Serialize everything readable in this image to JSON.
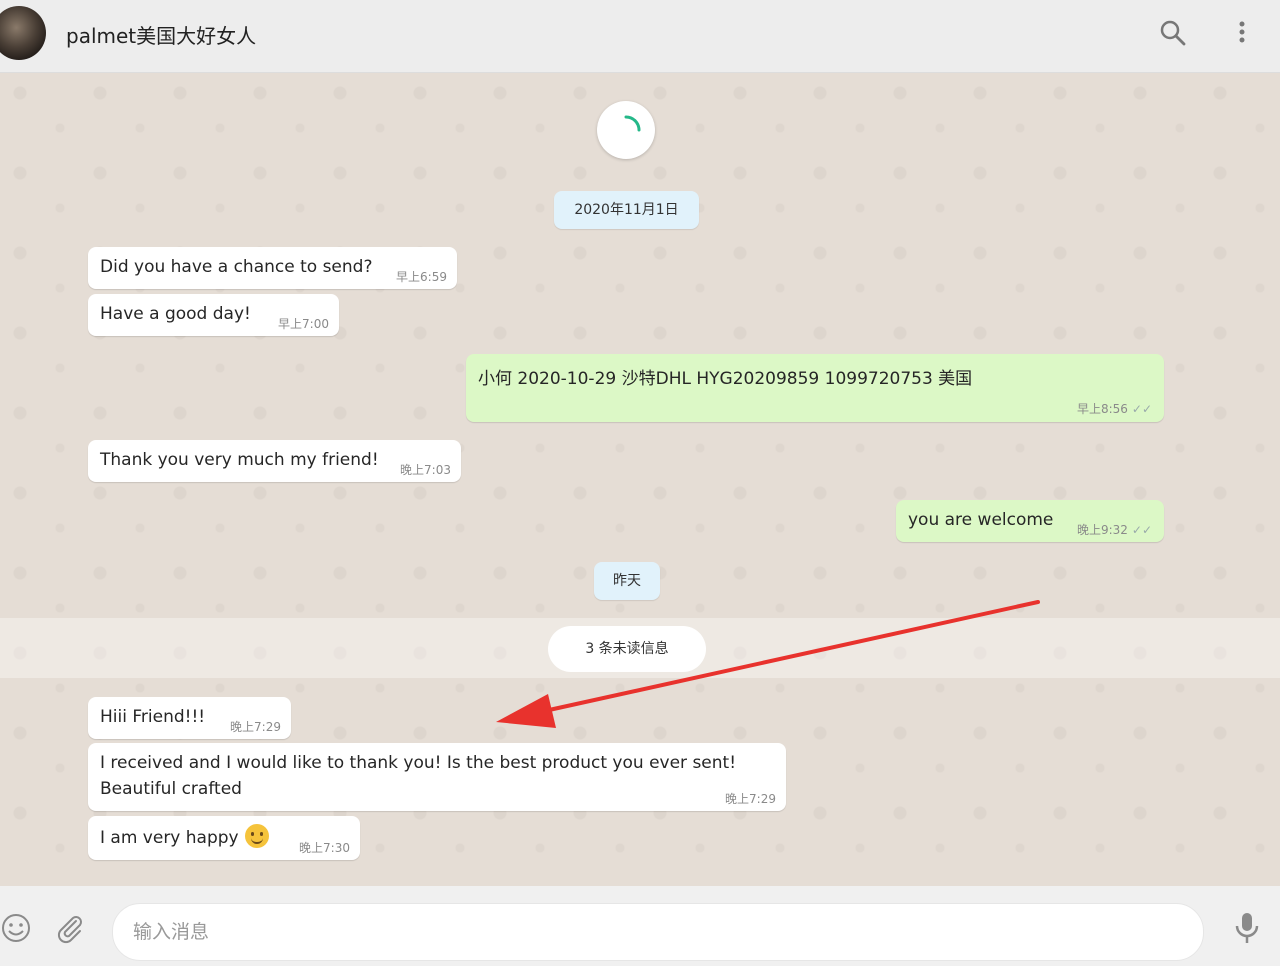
{
  "header": {
    "title": "palmet美国大好女人",
    "search_icon": "search-icon",
    "menu_icon": "menu-icon"
  },
  "chat": {
    "date_divider_1": "2020年11月1日",
    "date_divider_2": "昨天",
    "unread_label": "3 条未读信息",
    "messages": [
      {
        "dir": "in",
        "text": "Did you have a chance to send?",
        "time": "早上6:59"
      },
      {
        "dir": "in",
        "text": "Have a good day!",
        "time": "早上7:00"
      },
      {
        "dir": "out",
        "text": "小何 2020-10-29     沙特DHL          HYG20209859 1099720753     美国",
        "time": "早上8:56",
        "status": "✓✓"
      },
      {
        "dir": "in",
        "text": "Thank you very much my friend!",
        "time": "晚上7:03"
      },
      {
        "dir": "out",
        "text": "you are welcome",
        "time": "晚上9:32",
        "status": "✓✓"
      },
      {
        "dir": "in",
        "text": "Hiii Friend!!!",
        "time": "晚上7:29"
      },
      {
        "dir": "in",
        "text": "I received and I would like to thank you! Is the best product you ever sent!",
        "text2": "Beautiful crafted",
        "time": "晚上7:29"
      },
      {
        "dir": "in",
        "text": "I am very happy",
        "emoji": "smiling-face",
        "time": "晚上7:30"
      }
    ]
  },
  "composer": {
    "placeholder": "输入消息",
    "emoji_icon": "emoji-icon",
    "attach_icon": "paperclip-icon",
    "mic_icon": "microphone-icon"
  },
  "colors": {
    "incoming_bubble": "#ffffff",
    "outgoing_bubble": "#dcf8c6",
    "date_badge": "#e1f2fb",
    "annotation_arrow": "#e8322d"
  }
}
